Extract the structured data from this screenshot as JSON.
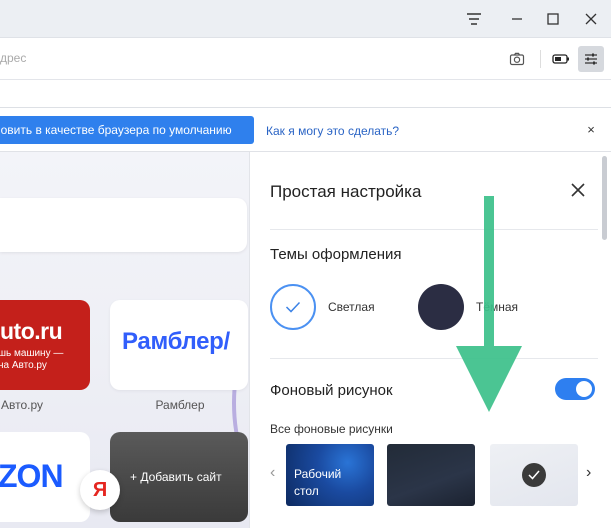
{
  "address_bar": {
    "placeholder": "дрес"
  },
  "default_bar": {
    "button_label": "новить в качестве браузера по умолчанию",
    "help_link": "Как я могу это сделать?",
    "close_glyph": "×"
  },
  "newtab": {
    "tiles": [
      {
        "big": "uto.ru",
        "small_line1": "шь машину —",
        "small_line2": "на Авто.ру",
        "label": "Авто.ру"
      },
      {
        "big": "Рамблер/",
        "label": "Рамблер"
      },
      {
        "big": "ZON"
      },
      {
        "add_label": "+ Добавить сайт"
      }
    ],
    "yandex_letter": "Я"
  },
  "panel": {
    "title": "Простая настройка",
    "themes_title": "Темы оформления",
    "theme_light": "Светлая",
    "theme_dark": "Тёмная",
    "background_title": "Фоновый рисунок",
    "background_enabled": true,
    "all_backgrounds": "Все фоновые рисунки",
    "thumb_1_line1": "Рабочий",
    "thumb_1_line2": "стол",
    "prev_arrow": "‹",
    "next_arrow": "›"
  },
  "colors": {
    "accent": "#2f80ed",
    "auto_red": "#c4201b",
    "rambler_blue": "#315efb",
    "dark_theme": "#2b2d43",
    "arrow_green": "#3cc08a"
  },
  "icons": [
    "hamburger-menu-icon",
    "minimize-icon",
    "maximize-icon",
    "close-icon",
    "camera-icon",
    "battery-icon",
    "settings-sliders-icon",
    "checkmark-icon"
  ]
}
